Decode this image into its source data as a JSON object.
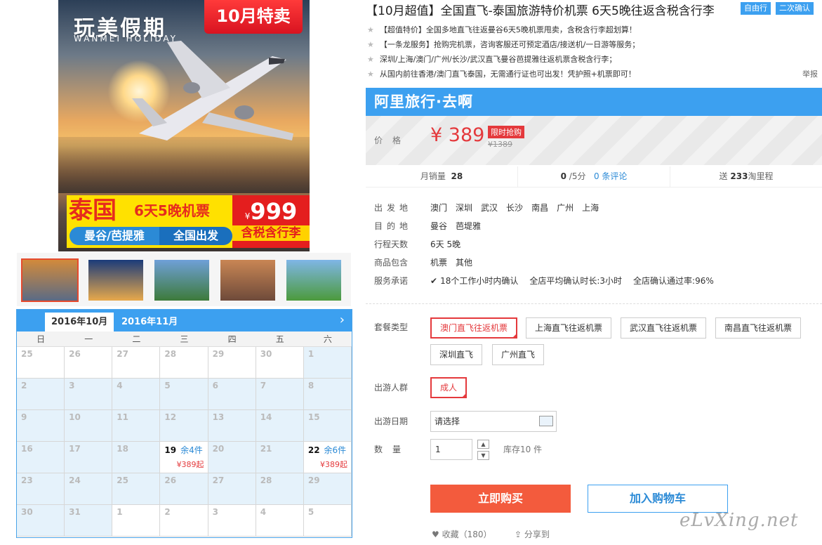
{
  "hero": {
    "brand_zh": "玩美假期",
    "brand_en": "WANMEI HOLIDAY",
    "sale_badge": "10月特卖",
    "country": "泰国",
    "days": "6天5晚机票",
    "cities": "曼谷/芭提雅",
    "depart_all": "全国出发",
    "price_yen": "¥",
    "price_num": "999",
    "tax": "含税含行李"
  },
  "thumbnails": [
    {
      "name": "plane-thumb",
      "colors": [
        "#d28a3b",
        "#5b6b85"
      ]
    },
    {
      "name": "temple-thumb",
      "colors": [
        "#1b3b7a",
        "#e8a94b"
      ]
    },
    {
      "name": "tower-thumb",
      "colors": [
        "#6fa0d8",
        "#3d7a3a"
      ]
    },
    {
      "name": "skyline-thumb",
      "colors": [
        "#c98654",
        "#6e4a3a"
      ]
    },
    {
      "name": "palace-thumb",
      "colors": [
        "#7fb6e6",
        "#4c9a3c"
      ]
    }
  ],
  "calendar": {
    "tabs": [
      "2016年10月",
      "2016年11月"
    ],
    "next_icon": "chevron-right-icon",
    "weekdays": [
      "日",
      "一",
      "二",
      "三",
      "四",
      "五",
      "六"
    ],
    "weeks": [
      [
        {
          "d": "25",
          "blue": false
        },
        {
          "d": "26",
          "blue": false
        },
        {
          "d": "27",
          "blue": false
        },
        {
          "d": "28",
          "blue": false
        },
        {
          "d": "29",
          "blue": false
        },
        {
          "d": "30",
          "blue": false
        },
        {
          "d": "1",
          "blue": true
        }
      ],
      [
        {
          "d": "2",
          "blue": true
        },
        {
          "d": "3",
          "blue": true
        },
        {
          "d": "4",
          "blue": true
        },
        {
          "d": "5",
          "blue": true
        },
        {
          "d": "6",
          "blue": true
        },
        {
          "d": "7",
          "blue": true
        },
        {
          "d": "8",
          "blue": true
        }
      ],
      [
        {
          "d": "9",
          "blue": true
        },
        {
          "d": "10",
          "blue": true
        },
        {
          "d": "11",
          "blue": true
        },
        {
          "d": "12",
          "blue": true
        },
        {
          "d": "13",
          "blue": true
        },
        {
          "d": "14",
          "blue": true
        },
        {
          "d": "15",
          "blue": true
        }
      ],
      [
        {
          "d": "16",
          "blue": true
        },
        {
          "d": "17",
          "blue": true
        },
        {
          "d": "18",
          "blue": true
        },
        {
          "d": "19",
          "blue": false,
          "avail": true,
          "stock": "余4件",
          "from": "¥389起"
        },
        {
          "d": "20",
          "blue": true
        },
        {
          "d": "21",
          "blue": true
        },
        {
          "d": "22",
          "blue": false,
          "avail": true,
          "stock": "余6件",
          "from": "¥389起"
        }
      ],
      [
        {
          "d": "23",
          "blue": true
        },
        {
          "d": "24",
          "blue": true
        },
        {
          "d": "25",
          "blue": true
        },
        {
          "d": "26",
          "blue": true
        },
        {
          "d": "27",
          "blue": true
        },
        {
          "d": "28",
          "blue": true
        },
        {
          "d": "29",
          "blue": true
        }
      ],
      [
        {
          "d": "30",
          "blue": true
        },
        {
          "d": "31",
          "blue": true
        },
        {
          "d": "1",
          "blue": false
        },
        {
          "d": "2",
          "blue": false
        },
        {
          "d": "3",
          "blue": false
        },
        {
          "d": "4",
          "blue": false
        },
        {
          "d": "5",
          "blue": false
        }
      ]
    ]
  },
  "product": {
    "title": "【10月超值】全国直飞-泰国旅游特价机票 6天5晚往返含税含行李",
    "tags": [
      "自由行",
      "二次确认"
    ],
    "features": [
      "【超值特价】全国多地直飞往返曼谷6天5晚机票甩卖，含税含行李超划算！",
      "【一条龙服务】抢购完机票，咨询客服还可预定酒店/接送机/一日游等服务；",
      "深圳/上海/澳门/广州/长沙/武汉直飞曼谷芭提雅往返机票含税含行李；",
      "从国内前往香港/澳门直飞泰国，无需通行证也可出发！凭护照+机票即可！"
    ],
    "report": "举报"
  },
  "price": {
    "banner": "阿里旅行·去啊",
    "label": "价格",
    "value": "¥ 389",
    "limited": "限时抢购",
    "original": "¥1389"
  },
  "stats": {
    "monthly_label": "月销量",
    "monthly_value": "28",
    "score_value": "0",
    "score_suffix": "/5分",
    "reviews": "0 条评论",
    "points_prefix": "送",
    "points_value": "233",
    "points_suffix": "淘里程"
  },
  "info": [
    {
      "key": "出发地",
      "values": [
        "澳门",
        "深圳",
        "武汉",
        "长沙",
        "南昌",
        "广州",
        "上海"
      ]
    },
    {
      "key": "目的地",
      "values": [
        "曼谷",
        "芭堤雅"
      ]
    },
    {
      "key": "行程天数",
      "values": [
        "6天 5晚"
      ]
    },
    {
      "key": "商品包含",
      "values": [
        "机票",
        "其他"
      ]
    },
    {
      "key": "服务承诺",
      "values": [
        "18个工作小时内确认",
        "全店平均确认时长:3小时",
        "全店确认通过率:96%"
      ]
    }
  ],
  "options": {
    "package_label": "套餐类型",
    "packages": [
      "澳门直飞往返机票",
      "上海直飞往返机票",
      "武汉直飞往返机票",
      "南昌直飞往返机票",
      "深圳直飞",
      "广州直飞"
    ],
    "group_label": "出游人群",
    "group": "成人",
    "date_label": "出游日期",
    "date_placeholder": "请选择",
    "qty_label": "数量",
    "qty_value": "1",
    "stock": "库存10 件"
  },
  "actions": {
    "buy": "立即购买",
    "cart": "加入购物车",
    "fav": "收藏（180）",
    "share": "分享到"
  },
  "watermark": "eLvXing.net",
  "colors": {
    "accent": "#3ca0f0",
    "price": "#e4393c",
    "buy": "#f35b3d"
  }
}
